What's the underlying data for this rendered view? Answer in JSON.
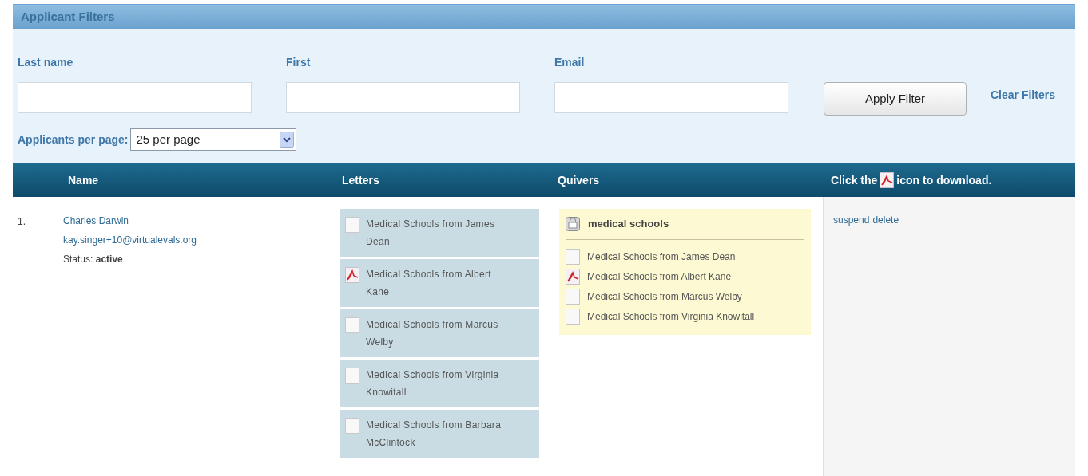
{
  "panel": {
    "title": "Applicant Filters"
  },
  "filters": [
    {
      "label": "Last name"
    },
    {
      "label": "First"
    },
    {
      "label": "Email"
    }
  ],
  "apply_button": "Apply Filter",
  "clear_link": "Clear Filters",
  "per_page": {
    "label": "Applicants per page:",
    "value": "25 per page"
  },
  "table": {
    "columns": [
      "Name",
      "Letters",
      "Quivers"
    ],
    "download_hint": {
      "before": "Click the",
      "after": "icon to download."
    },
    "rows": [
      {
        "number": "1.",
        "name": "Charles Darwin",
        "email": "kay.singer+10@virtualevals.org",
        "status_label": "Status:",
        "status": "active",
        "letters": [
          {
            "kind": "blank",
            "title": "Medical Schools from James Dean"
          },
          {
            "kind": "pdf",
            "title": "Medical Schools from Albert Kane"
          },
          {
            "kind": "blank",
            "title": "Medical Schools from Marcus Welby"
          },
          {
            "kind": "blank",
            "title": "Medical Schools from Virginia Knowitall"
          },
          {
            "kind": "blank",
            "title": "Medical Schools from Barbara McClintock"
          }
        ],
        "quiver": {
          "title": "medical schools",
          "items": [
            {
              "kind": "blank",
              "title": "Medical Schools from James Dean"
            },
            {
              "kind": "pdf",
              "title": "Medical Schools from Albert Kane"
            },
            {
              "kind": "blank",
              "title": "Medical Schools from Marcus Welby"
            },
            {
              "kind": "blank",
              "title": "Medical Schools from Virginia Knowitall"
            }
          ]
        },
        "actions": [
          "suspend",
          "delete"
        ]
      }
    ]
  }
}
